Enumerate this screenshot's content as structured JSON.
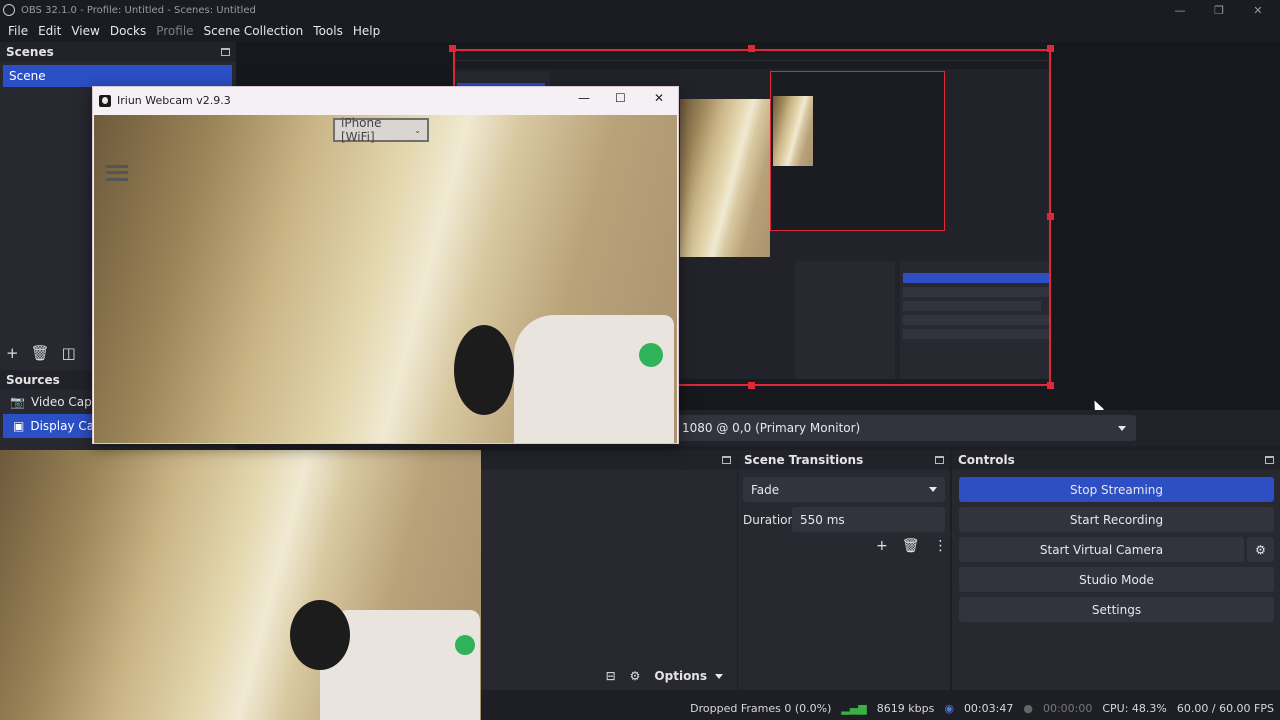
{
  "window": {
    "title": "OBS 32.1.0 - Profile: Untitled - Scenes: Untitled"
  },
  "menu": {
    "file": "File",
    "edit": "Edit",
    "view": "View",
    "docks": "Docks",
    "profile": "Profile",
    "scene_collection": "Scene Collection",
    "tools": "Tools",
    "help": "Help"
  },
  "scenes": {
    "title": "Scenes",
    "items": [
      "Scene"
    ]
  },
  "sources": {
    "title": "Sources",
    "items": [
      "Video Captur",
      "Display Capt"
    ]
  },
  "iriun": {
    "title": "Iriun Webcam v2.9.3",
    "device": "iPhone [WiFi]"
  },
  "display_selector": {
    "value": "1080 @ 0,0 (Primary Monitor)"
  },
  "mixer": {
    "options_label": "Options"
  },
  "transitions": {
    "title": "Scene Transitions",
    "transition": "Fade",
    "duration_label": "Duration",
    "duration_value": "550 ms"
  },
  "controls": {
    "title": "Controls",
    "stop_streaming": "Stop Streaming",
    "start_recording": "Start Recording",
    "start_virtual_camera": "Start Virtual Camera",
    "studio_mode": "Studio Mode",
    "settings": "Settings"
  },
  "status": {
    "dropped_frames": "Dropped Frames 0 (0.0%)",
    "bitrate": "8619 kbps",
    "stream_time": "00:03:47",
    "record_time": "00:00:00",
    "cpu": "CPU: 48.3%",
    "fps": "60.00 / 60.00 FPS"
  },
  "colors": {
    "accent": "#2e4ec4",
    "selection_red": "#e0283a",
    "streaming_green": "#3cb043"
  }
}
